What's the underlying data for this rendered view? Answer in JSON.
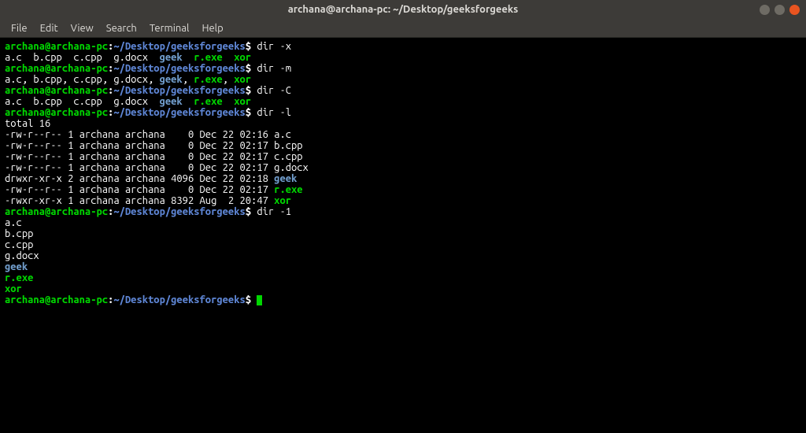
{
  "titlebar": {
    "title": "archana@archana-pc: ~/Desktop/geeksforgeeks"
  },
  "menubar": {
    "items": [
      "File",
      "Edit",
      "View",
      "Search",
      "Terminal",
      "Help"
    ]
  },
  "prompt": {
    "user_host": "archana@archana-pc",
    "colon": ":",
    "path": "~/Desktop/geeksforgeeks",
    "sep": "$"
  },
  "blocks": [
    {
      "cmd": " dir -x",
      "out": [
        [
          {
            "t": "a.c  b.cpp  c.cpp  g.docx  ",
            "c": "out"
          },
          {
            "t": "geek",
            "c": "dir-blue"
          },
          {
            "t": "  ",
            "c": "out"
          },
          {
            "t": "r.exe",
            "c": "exec-green"
          },
          {
            "t": "  ",
            "c": "out"
          },
          {
            "t": "xor",
            "c": "exec-green"
          }
        ]
      ]
    },
    {
      "cmd": " dir -m",
      "out": [
        [
          {
            "t": "a.c, b.cpp, c.cpp, g.docx, ",
            "c": "out"
          },
          {
            "t": "geek",
            "c": "dir-blue"
          },
          {
            "t": ", ",
            "c": "out"
          },
          {
            "t": "r.exe",
            "c": "exec-green"
          },
          {
            "t": ", ",
            "c": "out"
          },
          {
            "t": "xor",
            "c": "exec-green"
          }
        ]
      ]
    },
    {
      "cmd": " dir -C",
      "out": [
        [
          {
            "t": "a.c  b.cpp  c.cpp  g.docx  ",
            "c": "out"
          },
          {
            "t": "geek",
            "c": "dir-blue"
          },
          {
            "t": "  ",
            "c": "out"
          },
          {
            "t": "r.exe",
            "c": "exec-green"
          },
          {
            "t": "  ",
            "c": "out"
          },
          {
            "t": "xor",
            "c": "exec-green"
          }
        ]
      ]
    },
    {
      "cmd": " dir -l",
      "out": [
        [
          {
            "t": "total 16",
            "c": "out"
          }
        ],
        [
          {
            "t": "-rw-r--r-- 1 archana archana    0 Dec 22 02:16 a.c",
            "c": "out"
          }
        ],
        [
          {
            "t": "-rw-r--r-- 1 archana archana    0 Dec 22 02:17 b.cpp",
            "c": "out"
          }
        ],
        [
          {
            "t": "-rw-r--r-- 1 archana archana    0 Dec 22 02:17 c.cpp",
            "c": "out"
          }
        ],
        [
          {
            "t": "-rw-r--r-- 1 archana archana    0 Dec 22 02:17 g.docx",
            "c": "out"
          }
        ],
        [
          {
            "t": "drwxr-xr-x 2 archana archana 4096 Dec 22 02:18 ",
            "c": "out"
          },
          {
            "t": "geek",
            "c": "dir-blue"
          }
        ],
        [
          {
            "t": "-rw-r--r-- 1 archana archana    0 Dec 22 02:17 ",
            "c": "out"
          },
          {
            "t": "r.exe",
            "c": "exec-green"
          }
        ],
        [
          {
            "t": "-rwxr-xr-x 1 archana archana 8392 Aug  2 20:47 ",
            "c": "out"
          },
          {
            "t": "xor",
            "c": "exec-green"
          }
        ]
      ]
    },
    {
      "cmd": " dir -1",
      "out": [
        [
          {
            "t": "a.c",
            "c": "out"
          }
        ],
        [
          {
            "t": "b.cpp",
            "c": "out"
          }
        ],
        [
          {
            "t": "c.cpp",
            "c": "out"
          }
        ],
        [
          {
            "t": "g.docx",
            "c": "out"
          }
        ],
        [
          {
            "t": "geek",
            "c": "dir-blue"
          }
        ],
        [
          {
            "t": "r.exe",
            "c": "exec-green"
          }
        ],
        [
          {
            "t": "xor",
            "c": "exec-green"
          }
        ]
      ]
    },
    {
      "cmd": " ",
      "cursor": true,
      "out": []
    }
  ]
}
